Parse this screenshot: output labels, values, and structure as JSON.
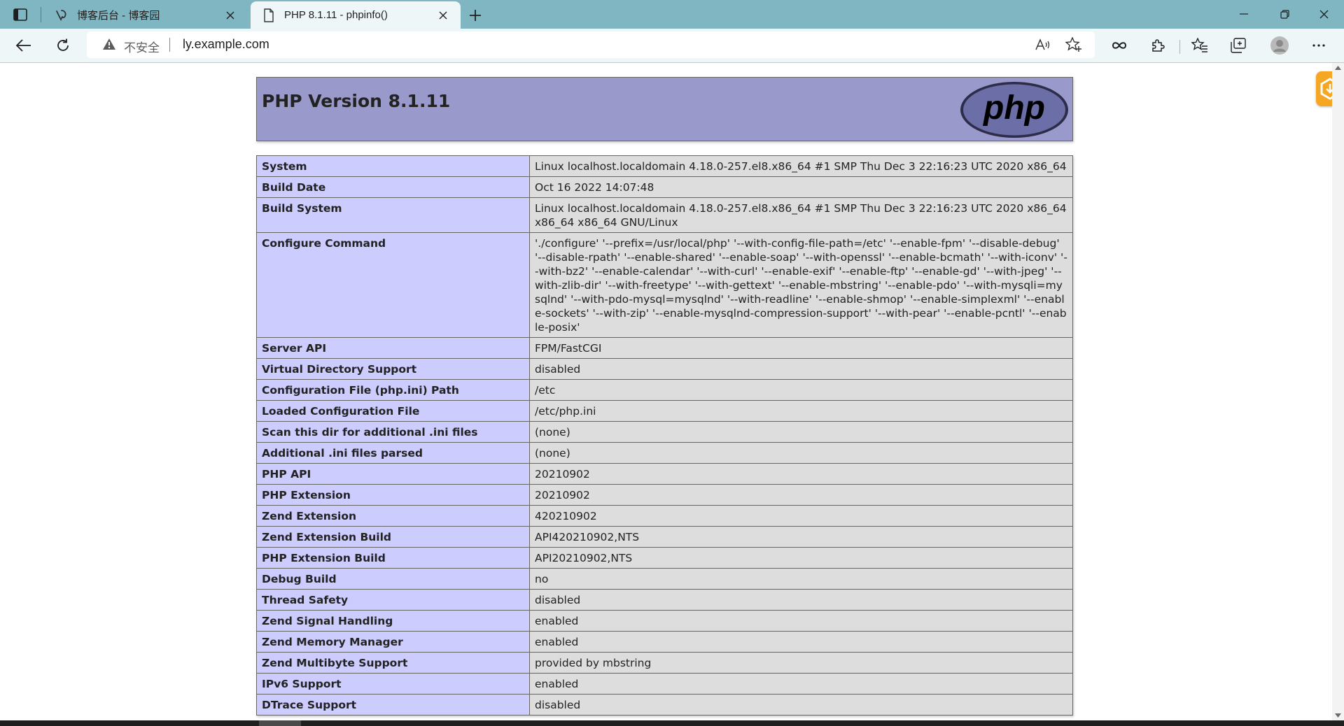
{
  "browser": {
    "tabs": [
      {
        "title": "博客后台 - 博客园",
        "active": false,
        "favicon": "cnblogs-icon"
      },
      {
        "title": "PHP 8.1.11 - phpinfo()",
        "active": true,
        "favicon": "page-icon"
      }
    ],
    "address": {
      "security_label": "不安全",
      "url": "ly.example.com"
    }
  },
  "page": {
    "title": "PHP Version 8.1.11",
    "logo_text": "php",
    "rows": [
      {
        "name": "System",
        "value": "Linux localhost.localdomain 4.18.0-257.el8.x86_64 #1 SMP Thu Dec 3 22:16:23 UTC 2020 x86_64"
      },
      {
        "name": "Build Date",
        "value": "Oct 16 2022 14:07:48"
      },
      {
        "name": "Build System",
        "value": "Linux localhost.localdomain 4.18.0-257.el8.x86_64 #1 SMP Thu Dec 3 22:16:23 UTC 2020 x86_64 x86_64 x86_64 GNU/Linux"
      },
      {
        "name": "Configure Command",
        "value": "'./configure' '--prefix=/usr/local/php' '--with-config-file-path=/etc' '--enable-fpm' '--disable-debug' '--disable-rpath' '--enable-shared' '--enable-soap' '--with-openssl' '--enable-bcmath' '--with-iconv' '--with-bz2' '--enable-calendar' '--with-curl' '--enable-exif' '--enable-ftp' '--enable-gd' '--with-jpeg' '--with-zlib-dir' '--with-freetype' '--with-gettext' '--enable-mbstring' '--enable-pdo' '--with-mysqli=mysqlnd' '--with-pdo-mysql=mysqlnd' '--with-readline' '--enable-shmop' '--enable-simplexml' '--enable-sockets' '--with-zip' '--enable-mysqlnd-compression-support' '--with-pear' '--enable-pcntl' '--enable-posix'"
      },
      {
        "name": "Server API",
        "value": "FPM/FastCGI"
      },
      {
        "name": "Virtual Directory Support",
        "value": "disabled"
      },
      {
        "name": "Configuration File (php.ini) Path",
        "value": "/etc"
      },
      {
        "name": "Loaded Configuration File",
        "value": "/etc/php.ini"
      },
      {
        "name": "Scan this dir for additional .ini files",
        "value": "(none)"
      },
      {
        "name": "Additional .ini files parsed",
        "value": "(none)"
      },
      {
        "name": "PHP API",
        "value": "20210902"
      },
      {
        "name": "PHP Extension",
        "value": "20210902"
      },
      {
        "name": "Zend Extension",
        "value": "420210902"
      },
      {
        "name": "Zend Extension Build",
        "value": "API420210902,NTS"
      },
      {
        "name": "PHP Extension Build",
        "value": "API20210902,NTS"
      },
      {
        "name": "Debug Build",
        "value": "no"
      },
      {
        "name": "Thread Safety",
        "value": "disabled"
      },
      {
        "name": "Zend Signal Handling",
        "value": "enabled"
      },
      {
        "name": "Zend Memory Manager",
        "value": "enabled"
      },
      {
        "name": "Zend Multibyte Support",
        "value": "provided by mbstring"
      },
      {
        "name": "IPv6 Support",
        "value": "enabled"
      },
      {
        "name": "DTrace Support",
        "value": "disabled"
      }
    ]
  },
  "colors": {
    "titlebar": "#7fb6c1",
    "header_bg": "#9999cc",
    "key_cell": "#ccccff",
    "value_cell": "#dddddd",
    "widget": "#f5a623"
  }
}
